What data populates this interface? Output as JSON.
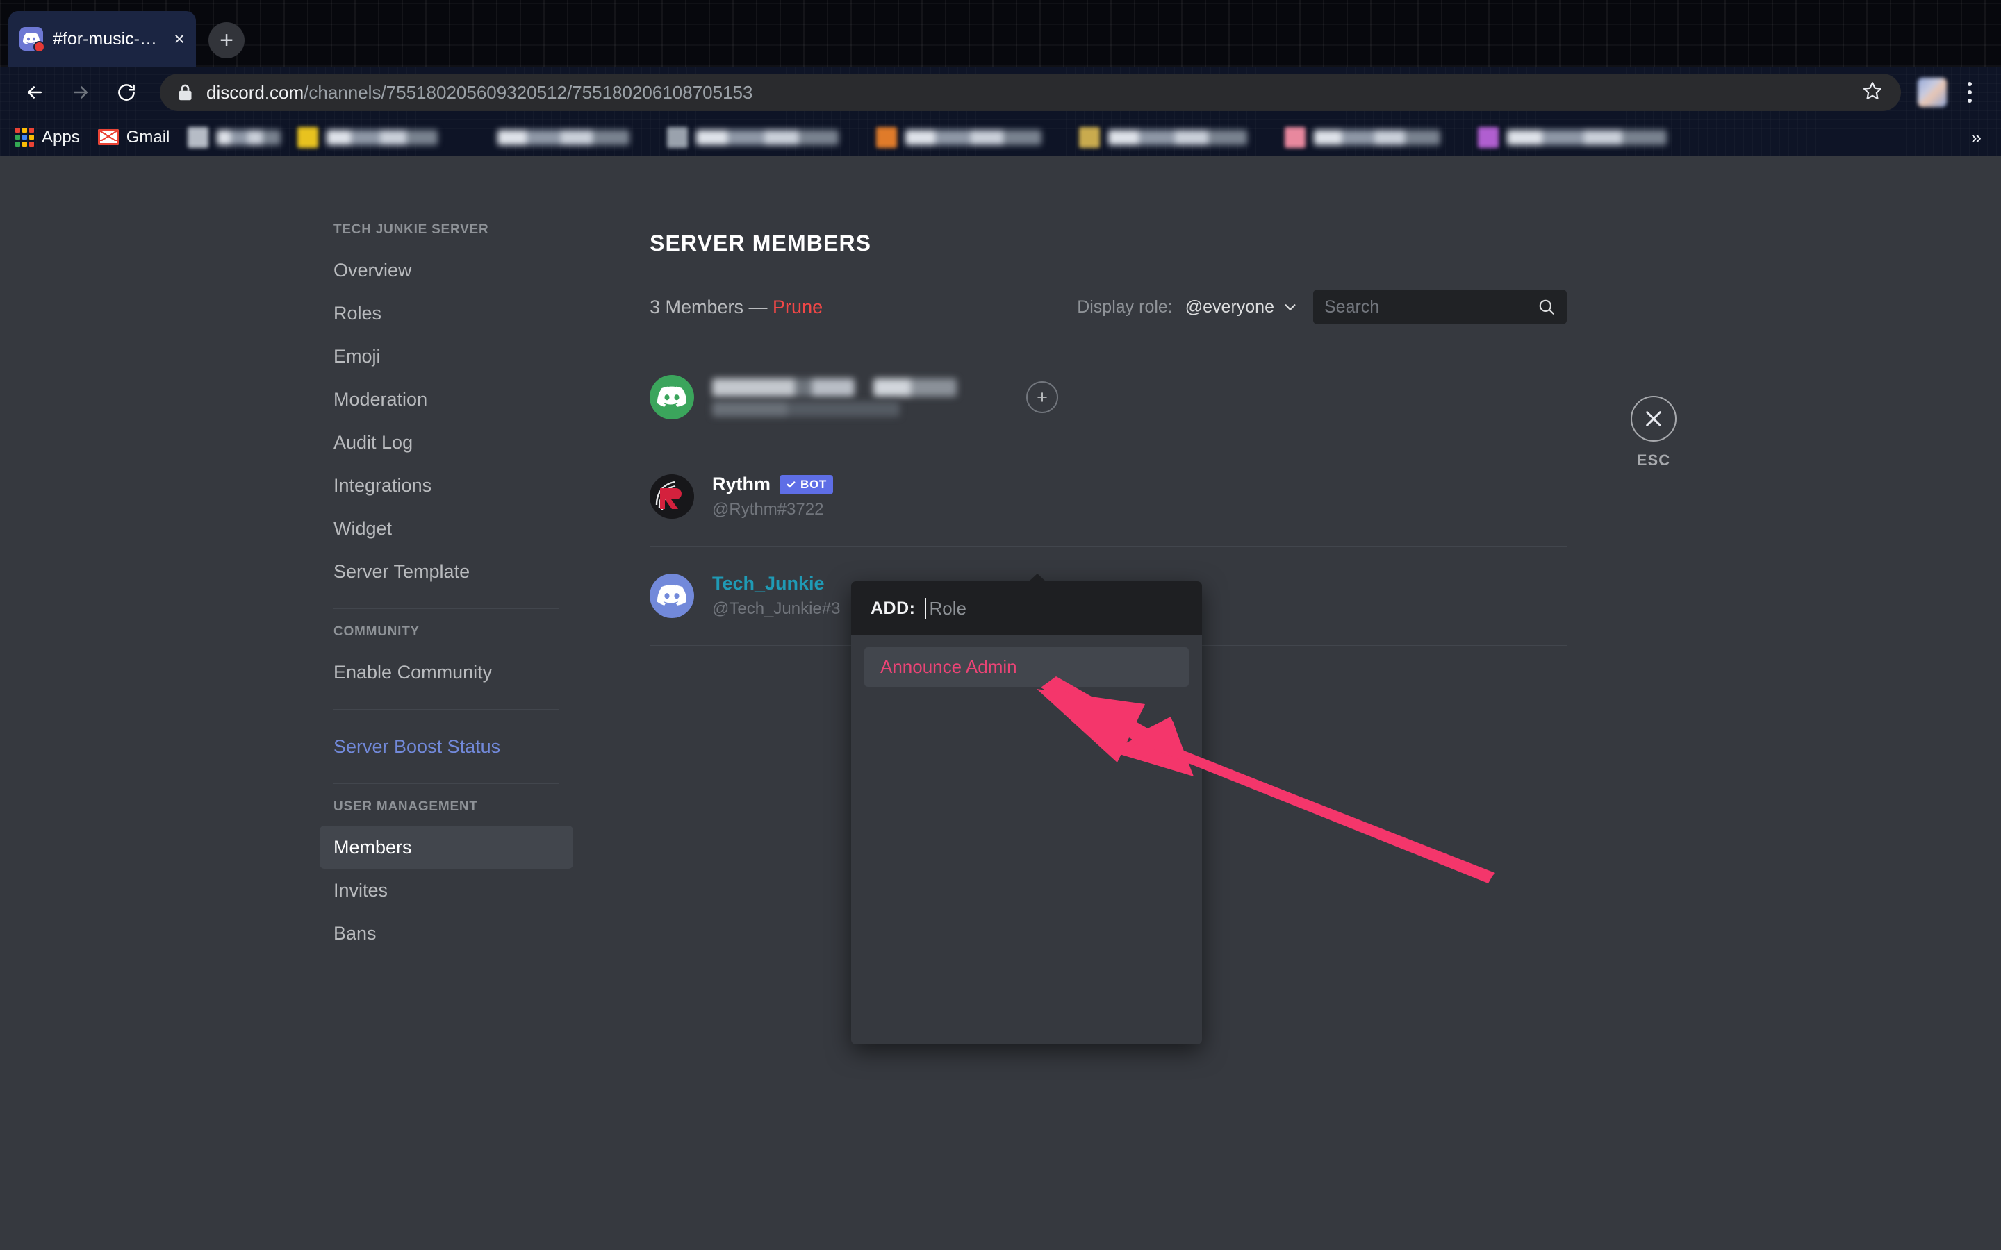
{
  "browser": {
    "tab": {
      "title": "#for-music-commands",
      "close_label": "×",
      "favicon": "discord-icon"
    },
    "new_tab_label": "+",
    "nav": {
      "back": "back-arrow-icon",
      "forward": "forward-arrow-icon",
      "reload": "reload-icon"
    },
    "url": {
      "host": "discord.com",
      "path": "/channels/755180205609320512/755180206108705153"
    },
    "bookmarks": {
      "apps_label": "Apps",
      "gmail_label": "Gmail",
      "overflow_label": "»",
      "redacted": [
        {
          "color": "#b6bcc6"
        },
        {
          "color": "#e8c21f"
        },
        {
          "color": "#7b8392"
        },
        {
          "color": "#9aa2ad"
        },
        {
          "color": "#e07b2a"
        },
        {
          "color": "#c9ab4e"
        },
        {
          "color": "#e8889e"
        },
        {
          "color": "#b05fd0"
        }
      ]
    }
  },
  "sidebar": {
    "server_heading": "TECH JUNKIE SERVER",
    "server_items": [
      {
        "label": "Overview"
      },
      {
        "label": "Roles"
      },
      {
        "label": "Emoji"
      },
      {
        "label": "Moderation"
      },
      {
        "label": "Audit Log"
      },
      {
        "label": "Integrations"
      },
      {
        "label": "Widget"
      },
      {
        "label": "Server Template"
      }
    ],
    "community_heading": "COMMUNITY",
    "community_items": [
      {
        "label": "Enable Community"
      }
    ],
    "boost_label": "Server Boost Status",
    "user_heading": "USER MANAGEMENT",
    "user_items": [
      {
        "label": "Members",
        "active": true
      },
      {
        "label": "Invites",
        "active": false
      },
      {
        "label": "Bans",
        "active": false
      }
    ]
  },
  "main": {
    "title": "SERVER MEMBERS",
    "member_count": "3 Members — ",
    "prune_label": "Prune",
    "display_role_label": "Display role:",
    "display_role_value": "@everyone",
    "search_placeholder": "Search",
    "add_role_label": "+",
    "members": [
      {
        "name": null,
        "tag": null,
        "redacted": true,
        "avatar_color": "#3ba55c",
        "name_color": "#ffffff",
        "is_bot": false
      },
      {
        "name": "Rythm",
        "tag": "@Rythm#3722",
        "redacted": false,
        "avatar_color": "#1f1f22",
        "name_color": "#ffffff",
        "is_bot": true,
        "bot_label": "BOT"
      },
      {
        "name": "Tech_Junkie",
        "tag": "@Tech_Junkie#3",
        "redacted": false,
        "avatar_color": "#7289da",
        "name_color": "#1f9ab5",
        "is_bot": false
      }
    ]
  },
  "popup": {
    "add_label": "ADD:",
    "role_placeholder": "Role",
    "options": [
      {
        "label": "Announce Admin",
        "color": "#eb4476"
      }
    ]
  },
  "esc": {
    "label": "ESC",
    "icon": "close-icon"
  },
  "annotation": {
    "color": "#f4366b",
    "type": "arrow",
    "points_to": "Announce Admin"
  },
  "colors": {
    "accent_blurple": "#5e6ee6",
    "danger_red": "#f04747",
    "boost_blue": "#7289da",
    "role_pink": "#eb4476",
    "annotation_pink": "#f4366b",
    "app_bg": "#36393f",
    "popup_header_bg": "#1e1f22"
  }
}
